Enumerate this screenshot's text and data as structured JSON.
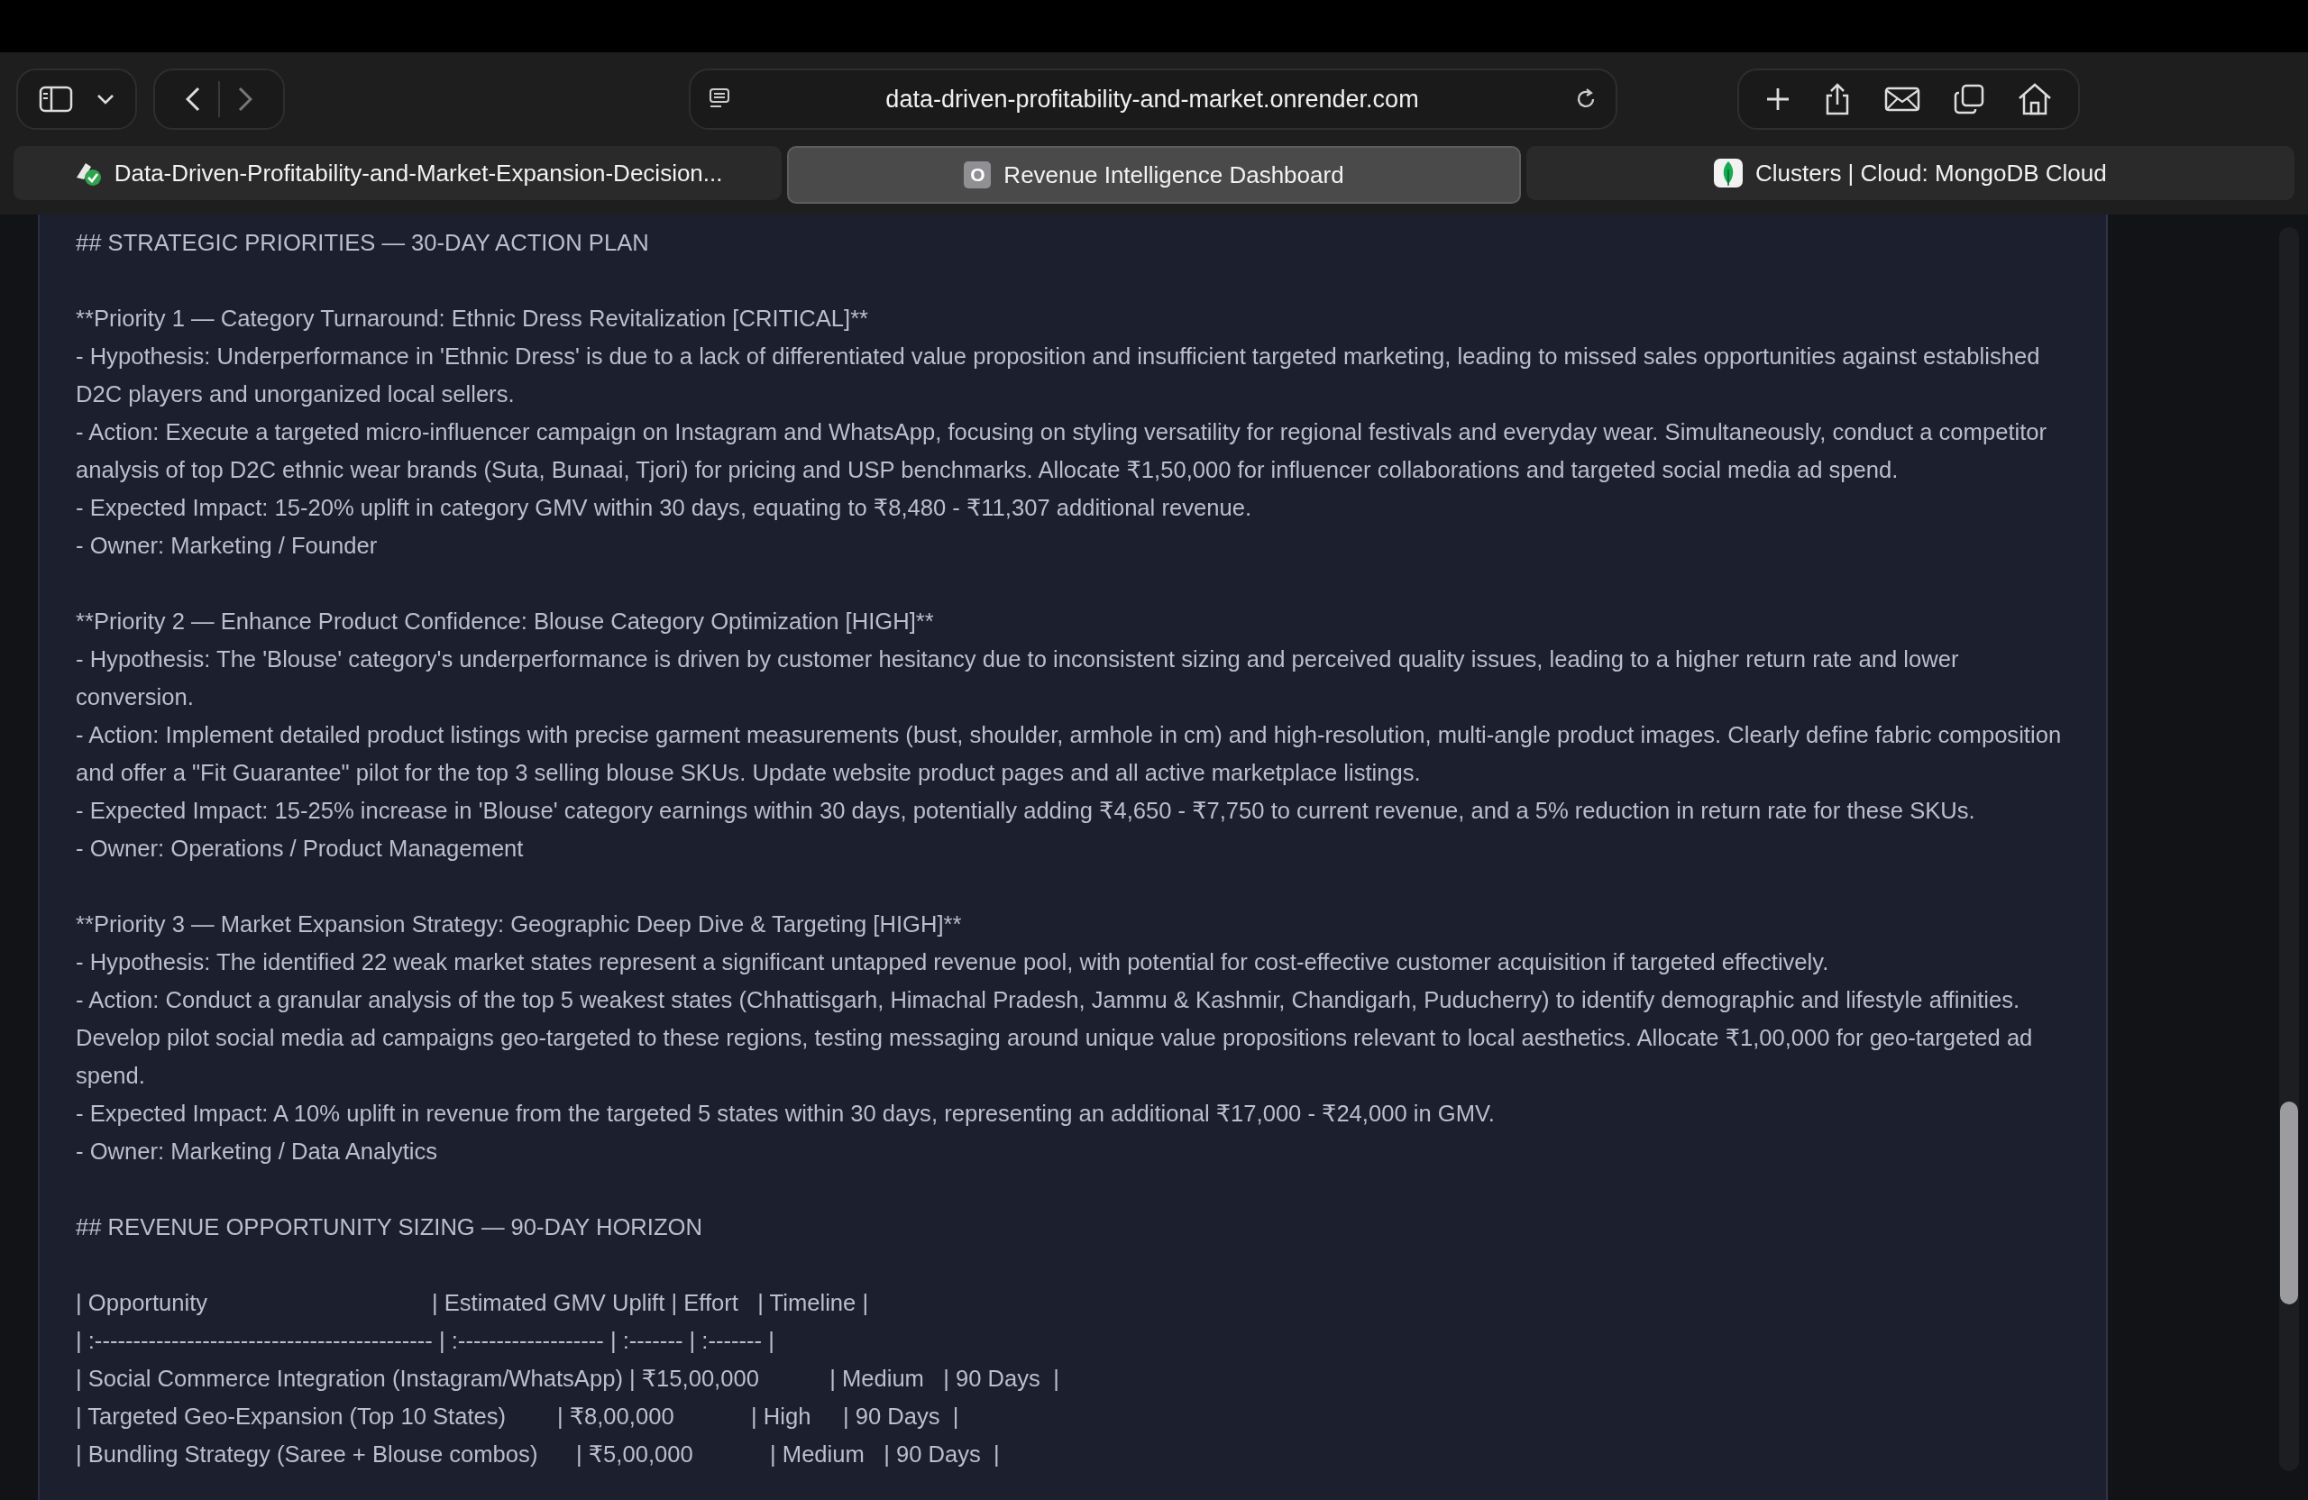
{
  "browser": {
    "url": "data-driven-profitability-and-market.onrender.com",
    "tabs": [
      {
        "title": "Data-Driven-Profitability-and-Market-Expansion-Decision...",
        "kind": "check",
        "selected": false
      },
      {
        "title": "Revenue Intelligence Dashboard",
        "kind": "letter",
        "favicon_text": "O",
        "selected": true
      },
      {
        "title": "Clusters | Cloud: MongoDB Cloud",
        "kind": "leaf",
        "selected": false
      }
    ]
  },
  "document": {
    "blocks": [
      {
        "lines": [
          "## STRATEGIC PRIORITIES — 30-DAY ACTION PLAN"
        ]
      },
      {
        "lines": [
          "**Priority 1 — Category Turnaround: Ethnic Dress Revitalization [CRITICAL]**",
          "- Hypothesis: Underperformance in 'Ethnic Dress' is due to a lack of differentiated value proposition and insufficient targeted marketing, leading to missed sales opportunities against established D2C players and unorganized local sellers.",
          "- Action: Execute a targeted micro-influencer campaign on Instagram and WhatsApp, focusing on styling versatility for regional festivals and everyday wear. Simultaneously, conduct a competitor analysis of top D2C ethnic wear brands (Suta, Bunaai, Tjori) for pricing and USP benchmarks. Allocate ₹1,50,000 for influencer collaborations and targeted social media ad spend.",
          "- Expected Impact: 15-20% uplift in category GMV within 30 days, equating to ₹8,480 - ₹11,307 additional revenue.",
          "- Owner: Marketing / Founder"
        ]
      },
      {
        "lines": [
          "**Priority 2 — Enhance Product Confidence: Blouse Category Optimization [HIGH]**",
          "- Hypothesis: The 'Blouse' category's underperformance is driven by customer hesitancy due to inconsistent sizing and perceived quality issues, leading to a higher return rate and lower conversion.",
          "- Action: Implement detailed product listings with precise garment measurements (bust, shoulder, armhole in cm) and high-resolution, multi-angle product images. Clearly define fabric composition and offer a \"Fit Guarantee\" pilot for the top 3 selling blouse SKUs. Update website product pages and all active marketplace listings.",
          "- Expected Impact: 15-25% increase in 'Blouse' category earnings within 30 days, potentially adding ₹4,650 - ₹7,750 to current revenue, and a 5% reduction in return rate for these SKUs.",
          "- Owner: Operations / Product Management"
        ]
      },
      {
        "lines": [
          "**Priority 3 — Market Expansion Strategy: Geographic Deep Dive & Targeting [HIGH]**",
          "- Hypothesis: The identified 22 weak market states represent a significant untapped revenue pool, with potential for cost-effective customer acquisition if targeted effectively.",
          "- Action: Conduct a granular analysis of the top 5 weakest states (Chhattisgarh, Himachal Pradesh, Jammu & Kashmir, Chandigarh, Puducherry) to identify demographic and lifestyle affinities. Develop pilot social media ad campaigns geo-targeted to these regions, testing messaging around unique value propositions relevant to local aesthetics. Allocate ₹1,00,000 for geo-targeted ad spend.",
          "- Expected Impact: A 10% uplift in revenue from the targeted 5 states within 30 days, representing an additional ₹17,000 - ₹24,000 in GMV.",
          "- Owner: Marketing / Data Analytics"
        ]
      },
      {
        "lines": [
          "## REVENUE OPPORTUNITY SIZING — 90-DAY HORIZON"
        ]
      },
      {
        "lines": [
          "| Opportunity                                   | Estimated GMV Uplift | Effort   | Timeline |",
          "| :-------------------------------------------- | :------------------- | :------- | :------- |",
          "| Social Commerce Integration (Instagram/WhatsApp) | ₹15,00,000           | Medium   | 90 Days  |",
          "| Targeted Geo-Expansion (Top 10 States)        | ₹8,00,000            | High     | 90 Days  |",
          "| Bundling Strategy (Saree + Blouse combos)      | ₹5,00,000            | Medium   | 90 Days  |"
        ]
      }
    ]
  }
}
